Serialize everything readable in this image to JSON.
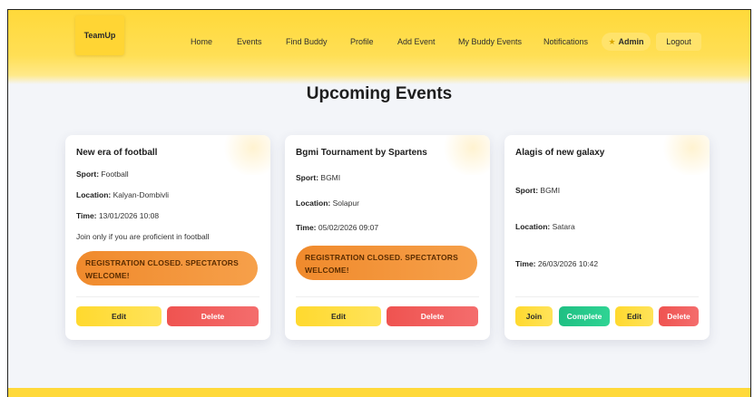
{
  "nav": {
    "logo_text": "TeamUp",
    "links": [
      "Home",
      "Events",
      "Find Buddy",
      "Profile",
      "Add Event",
      "My Buddy Events",
      "Notifications"
    ],
    "admin_label": "Admin",
    "admin_icon": "star-icon",
    "logout_label": "Logout"
  },
  "page": {
    "title": "Upcoming Events"
  },
  "labels": {
    "sport": "Sport:",
    "location": "Location:",
    "time": "Time:"
  },
  "events": [
    {
      "title": "New era of football",
      "sport": "Football",
      "location": "Kalyan-Dombivli",
      "time": "13/01/2026 10:08",
      "description": "Join only if you are proficient in football",
      "status": "REGISTRATION CLOSED. SPECTATORS WELCOME!",
      "buttons": [
        "Edit",
        "Delete"
      ]
    },
    {
      "title": "Bgmi Tournament by Spartens",
      "sport": "BGMI",
      "location": "Solapur",
      "time": "05/02/2026 09:07",
      "status": "REGISTRATION CLOSED. SPECTATORS WELCOME!",
      "buttons": [
        "Edit",
        "Delete"
      ]
    },
    {
      "title": "Alagis of new galaxy",
      "sport": "BGMI",
      "location": "Satara",
      "time": "26/03/2026 10:42",
      "buttons": [
        "Join",
        "Complete",
        "Edit",
        "Delete"
      ]
    }
  ],
  "colors": {
    "nav_yellow": "#ffd93a",
    "banner_orange": "#f08a2c",
    "delete_red": "#ef5350",
    "complete_green": "#1fbf83"
  }
}
